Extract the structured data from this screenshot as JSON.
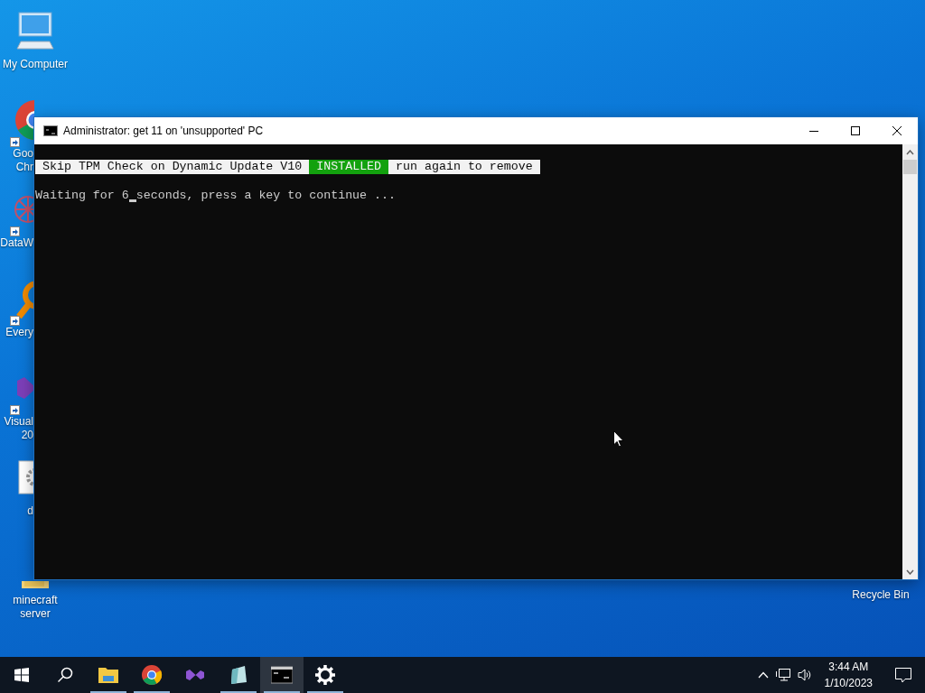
{
  "desktop_icons": [
    {
      "kind": "computer",
      "lines": [
        "My Computer"
      ],
      "covered": false,
      "shortcut": false
    },
    {
      "kind": "chrome",
      "lines": [
        "Goo",
        "Chr"
      ],
      "covered": true,
      "shortcut": true
    },
    {
      "kind": "network",
      "lines": [
        "DataW"
      ],
      "covered": true,
      "shortcut": true
    },
    {
      "kind": "magnifier",
      "lines": [
        "Every"
      ],
      "covered": true,
      "shortcut": true
    },
    {
      "kind": "studio",
      "lines": [
        "Visual",
        "20"
      ],
      "covered": true,
      "shortcut": true
    },
    {
      "kind": "settings-file",
      "lines": [
        "d"
      ],
      "covered": true,
      "shortcut": false
    },
    {
      "kind": "folder",
      "lines": [
        "minecraft",
        "server"
      ],
      "covered": false,
      "shortcut": false
    }
  ],
  "recycle_bin": {
    "label": "Recycle Bin"
  },
  "console": {
    "title": "Administrator:  get 11 on 'unsupported' PC",
    "banner": [
      {
        "text": "Skip TPM Check on Dynamic Update V10",
        "kind": "plain"
      },
      {
        "text": "INSTALLED",
        "kind": "success"
      },
      {
        "text": "run again to remove",
        "kind": "plain"
      }
    ],
    "prompt": {
      "before": "Waiting for 6",
      "after": "seconds, press a key to continue ..."
    }
  },
  "taskbar": {
    "apps": [
      {
        "kind": "explorer",
        "running": true,
        "selected": false
      },
      {
        "kind": "chrome",
        "running": true,
        "selected": false
      },
      {
        "kind": "studio",
        "running": false,
        "selected": false
      },
      {
        "kind": "notepad",
        "running": true,
        "selected": false
      },
      {
        "kind": "terminal",
        "running": true,
        "selected": true
      },
      {
        "kind": "settings",
        "running": true,
        "selected": false
      }
    ],
    "time": "3:44 AM",
    "date": "1/10/2023"
  }
}
